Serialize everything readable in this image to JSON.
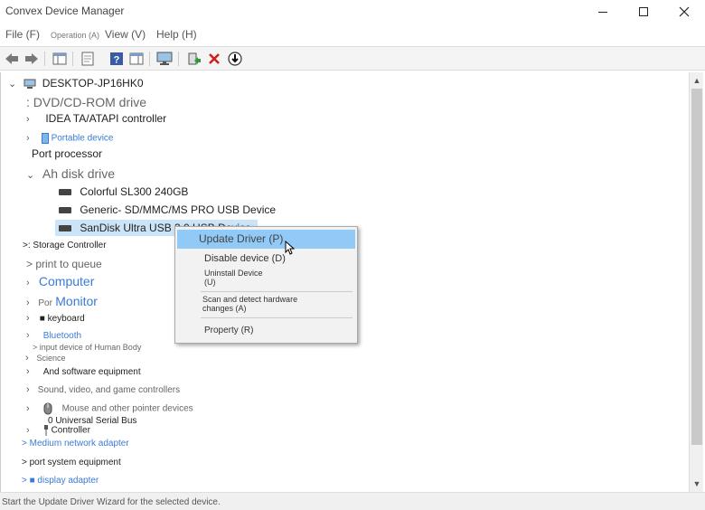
{
  "window": {
    "title": "Convex Device Manager"
  },
  "menu": {
    "file": "File (F)",
    "operation": "Operation (A)",
    "view": "View (V)",
    "help": "Help (H)"
  },
  "tree": {
    "root": "DESKTOP-JP16HK0",
    "items": {
      "dvd": ": DVD/CD-ROM drive",
      "ide": "IDEA TA/ATAPI controller",
      "portable": "Portable device",
      "port_processor": "Port processor",
      "disk": "Ah disk drive",
      "disk1": "Colorful SL300 240GB",
      "disk2": "Generic- SD/MMC/MS PRO USB Device",
      "disk3": "SanDisk Ultra USB 3.0 USB Device",
      "storage": ">: Storage Controller",
      "print": "> print to queue",
      "computer": "Computer",
      "por": "Por",
      "monitor": "Monitor",
      "keyboard": "■ keyboard",
      "bluetooth": "Bluetooth",
      "hid1": "> input device of Human Body",
      "hid2": "Science",
      "software": "And software equipment",
      "sound": "Sound, video, and game controllers",
      "mouse": "Mouse and other pointer devices",
      "usb1": "0 Universal Serial Bus",
      "usb2": "Controller",
      "network": "> Medium network adapter",
      "portsys": "> port system equipment",
      "display": "> ■ display adapter"
    }
  },
  "context_menu": {
    "update": "Update Driver (P)",
    "disable": "Disable device (D)",
    "uninstall1": "Uninstall Device",
    "uninstall2": "(U)",
    "scan1": "Scan and detect hardware",
    "scan2": "changes (A)",
    "property": "Property (R)"
  },
  "status": {
    "text": "Start the Update Driver Wizard for the selected device."
  },
  "colors": {
    "selection": "#cce4f7",
    "highlight": "#91c9f7",
    "link": "#3a7bd5"
  }
}
